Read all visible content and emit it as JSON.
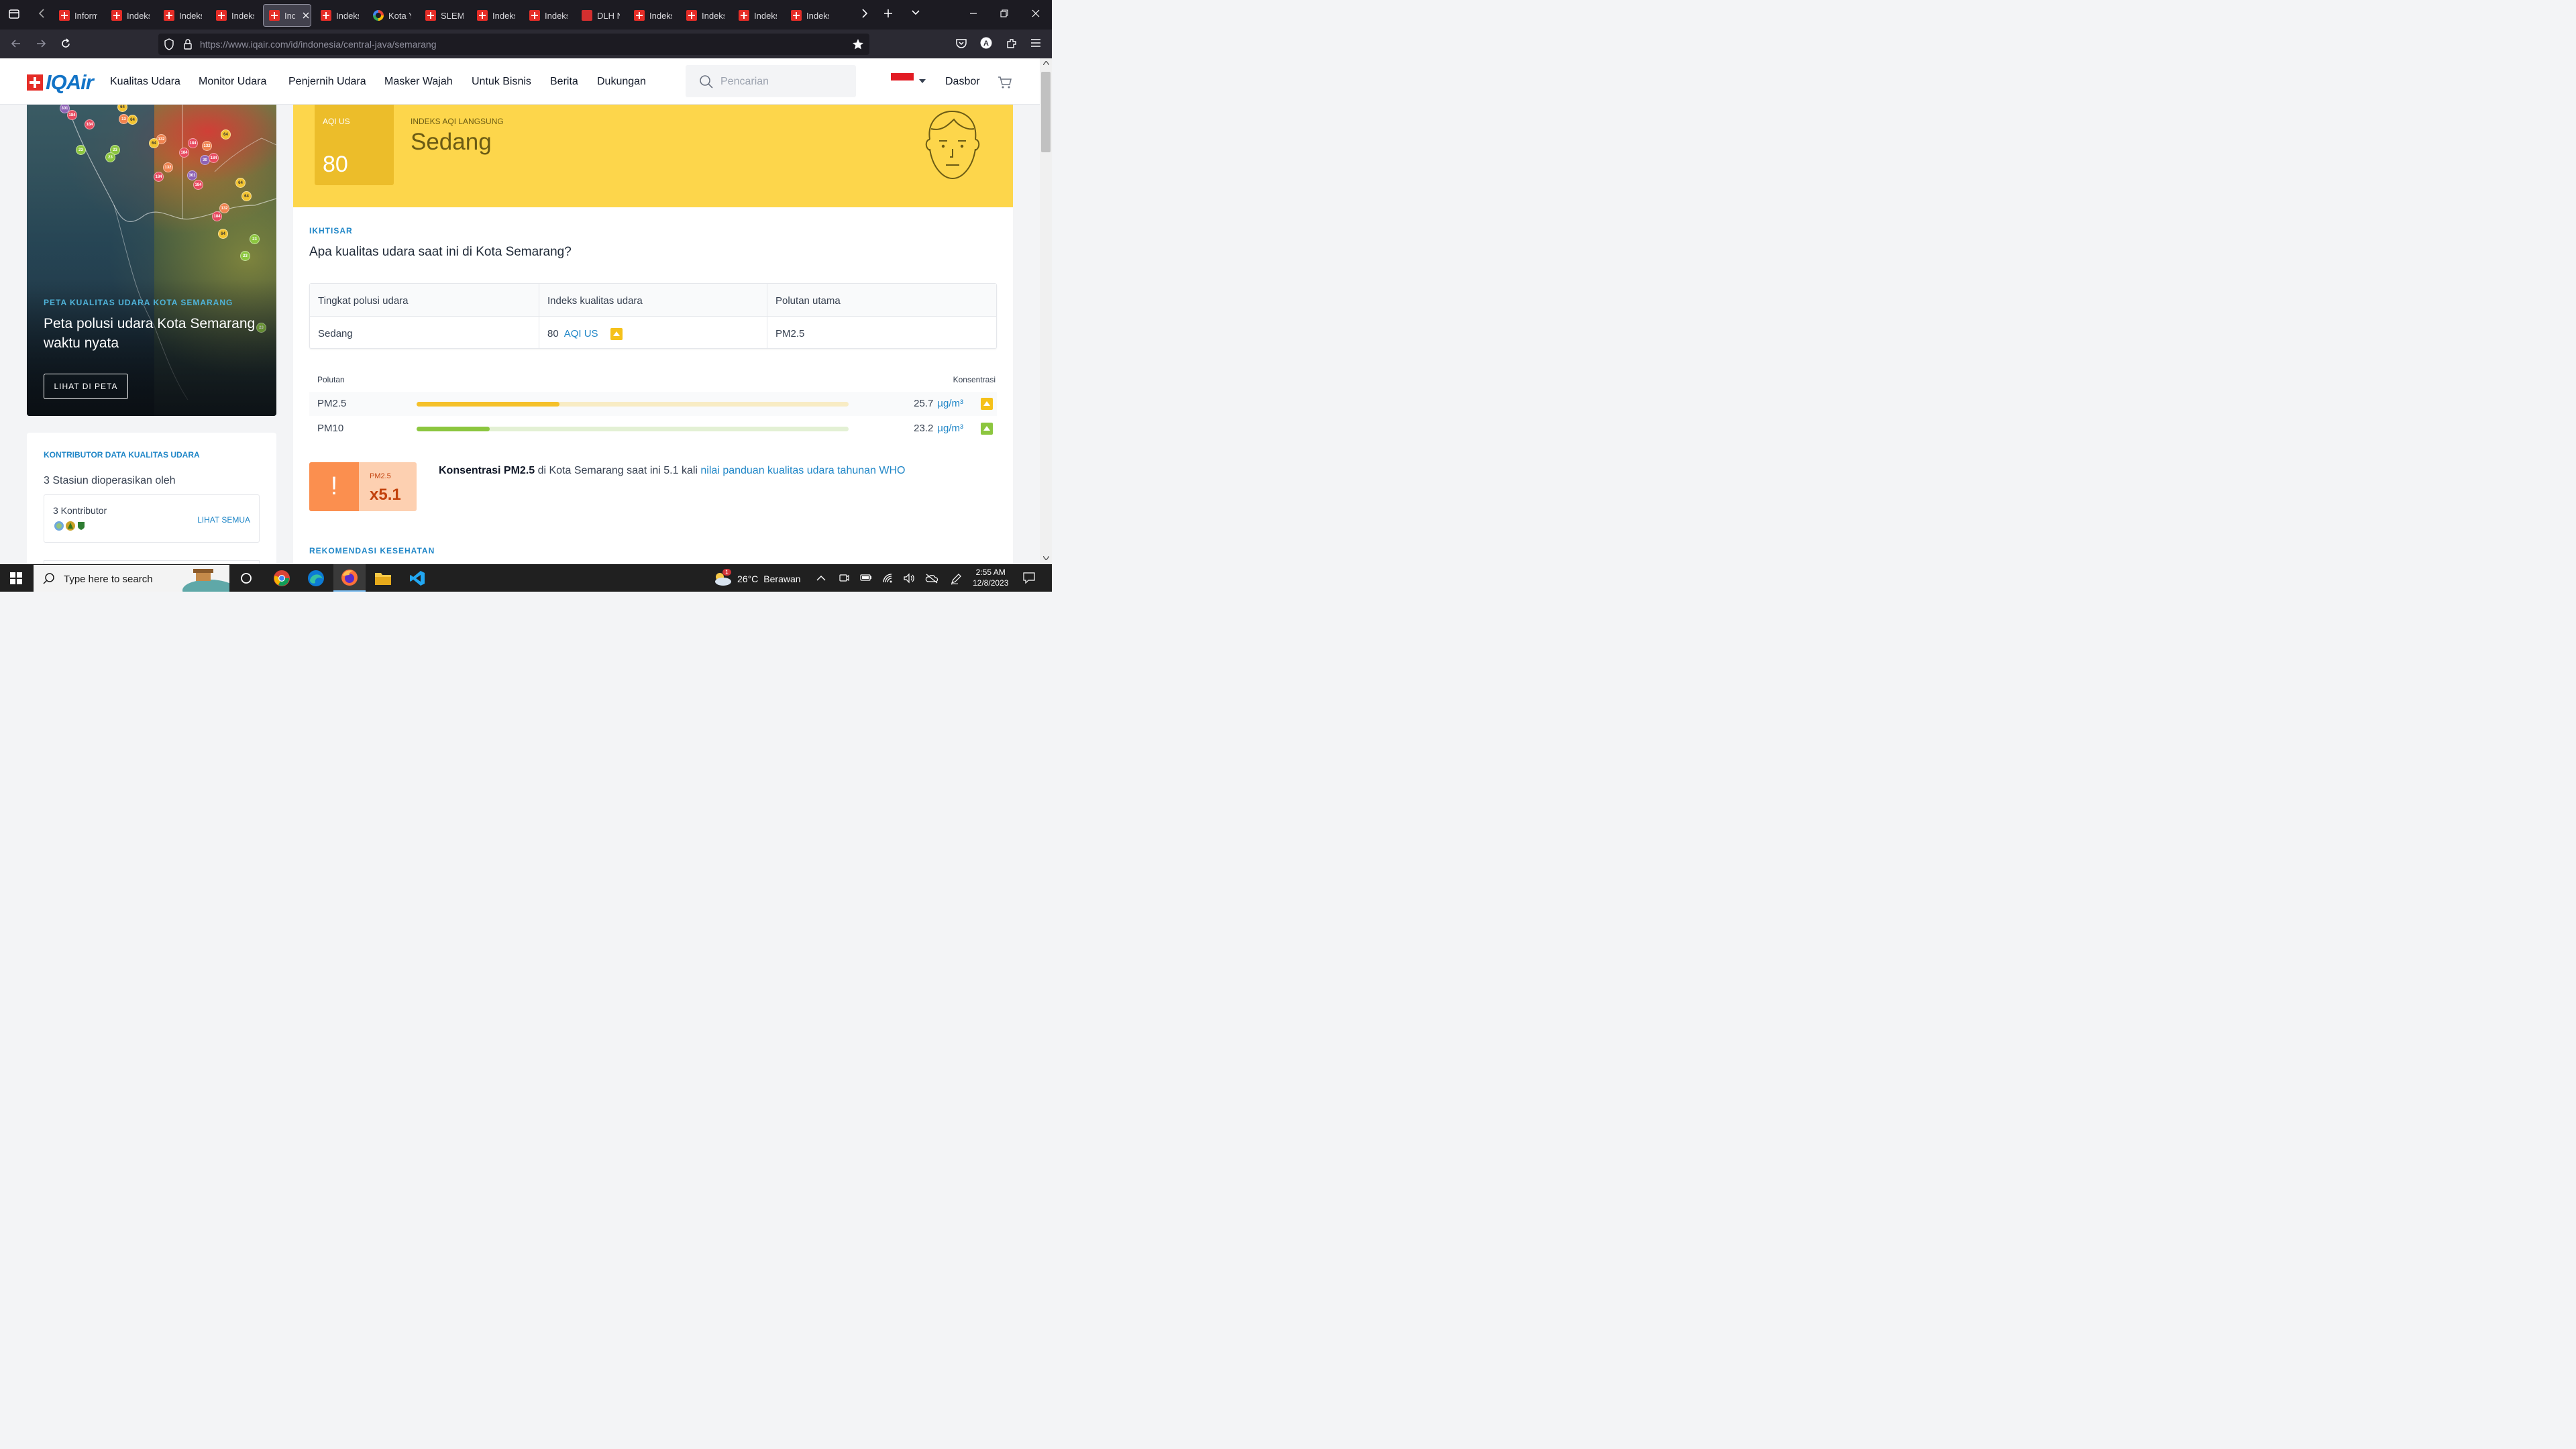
{
  "browser": {
    "tabs": [
      {
        "label": "Inform",
        "icon": "iqair-favicon"
      },
      {
        "label": "Indeks",
        "icon": "iqair-favicon"
      },
      {
        "label": "Indeks",
        "icon": "iqair-favicon"
      },
      {
        "label": "Indeks",
        "icon": "iqair-favicon"
      },
      {
        "label": "Ind",
        "icon": "iqair-favicon",
        "active": true
      },
      {
        "label": "Indeks",
        "icon": "iqair-favicon"
      },
      {
        "label": "Kota Y",
        "icon": "google-favicon"
      },
      {
        "label": "SLEMA",
        "icon": "iqair-favicon"
      },
      {
        "label": "Indeks",
        "icon": "iqair-favicon"
      },
      {
        "label": "Indeks",
        "icon": "iqair-favicon"
      },
      {
        "label": "DLH N",
        "icon": "dlh-favicon"
      },
      {
        "label": "Indeks",
        "icon": "iqair-favicon"
      },
      {
        "label": "Indeks",
        "icon": "iqair-favicon"
      },
      {
        "label": "Indeks",
        "icon": "iqair-favicon"
      },
      {
        "label": "Indeks",
        "icon": "iqair-favicon"
      }
    ],
    "url": "https://www.iqair.com/id/indonesia/central-java/semarang",
    "profile_initial": "A"
  },
  "site": {
    "logo": "IQAir",
    "menu": [
      "Kualitas Udara",
      "Monitor Udara",
      "Penjernih Udara",
      "Masker Wajah",
      "Untuk Bisnis",
      "Berita",
      "Dukungan"
    ],
    "search_placeholder": "Pencarian",
    "dashboard": "Dasbor"
  },
  "map_card": {
    "kicker": "PETA KUALITAS UDARA KOTA SEMARANG",
    "title": "Peta polusi udara Kota Semarang waktu nyata",
    "button": "LIHAT DI PETA",
    "markers": [
      "301",
      "184",
      "184",
      "64",
      "13",
      "64",
      "132",
      "64",
      "184",
      "23",
      "23",
      "23",
      "64",
      "184",
      "132",
      "30",
      "184",
      "132",
      "184",
      "301",
      "184",
      "64",
      "64",
      "132",
      "184",
      "64",
      "23",
      "23",
      "23"
    ]
  },
  "contributors": {
    "kicker": "KONTRIBUTOR DATA KUALITAS UDARA",
    "summary": "3 Stasiun dioperasikan oleh",
    "count": "3 Kontributor",
    "see_all": "LIHAT SEMUA"
  },
  "aqi": {
    "label": "AQI US",
    "value": "80",
    "live_label": "INDEKS AQI LANGSUNG",
    "status": "Sedang",
    "color": "#fdd64b"
  },
  "overview": {
    "kicker": "IKHTISAR",
    "title": "Apa kualitas udara saat ini di Kota Semarang?",
    "headers": [
      "Tingkat polusi udara",
      "Indeks kualitas udara",
      "Polutan utama"
    ],
    "level": "Sedang",
    "index_value": "80",
    "index_unit": "AQI US",
    "main_pollutant": "PM2.5"
  },
  "pollutants": {
    "col_pollutant": "Polutan",
    "col_concentration": "Konsentrasi",
    "rows": [
      {
        "name": "PM2.5",
        "value": "25.7",
        "unit": "µg/m³",
        "level_fraction": 0.33,
        "color": "#f5c12a"
      },
      {
        "name": "PM10",
        "value": "23.2",
        "unit": "µg/m³",
        "level_fraction": 0.17,
        "color": "#8cc63f"
      }
    ]
  },
  "who": {
    "pollutant": "PM2.5",
    "multiple": "x5.1",
    "text_bold": "Konsentrasi PM2.5",
    "text_mid": " di Kota Semarang saat ini 5.1 kali ",
    "text_link": "nilai panduan kualitas udara tahunan WHO"
  },
  "health": {
    "kicker": "REKOMENDASI KESEHATAN"
  },
  "taskbar": {
    "search_placeholder": "Type here to search",
    "weather_temp": "26°C",
    "weather_desc": "Berawan",
    "weather_badge": "1",
    "time": "2:55 AM",
    "date": "12/8/2023"
  }
}
